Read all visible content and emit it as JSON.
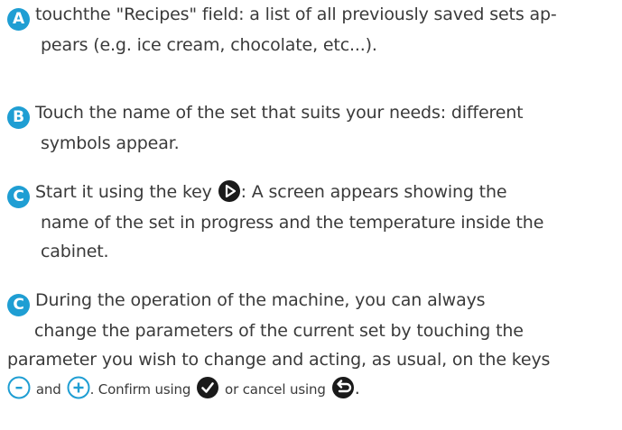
{
  "steps": [
    {
      "letter": "A",
      "line1": "touchthe \"Recipes\" field: a list of all previously saved sets ap-",
      "line2": "pears (e.g. ice cream, chocolate, etc...)."
    },
    {
      "letter": "B",
      "line1": "Touch the name of the set that suits your needs: different",
      "line2": "symbols appear."
    },
    {
      "letter": "C",
      "line1_before": "Start it using the key",
      "line1_after": ": A screen appears showing the",
      "line2": "name of the set in progress and the temperature inside the",
      "line3": "cabinet."
    },
    {
      "letter": "C",
      "line1": "During the operation of the machine, you can always",
      "line2": "change the parameters of the current set by touching the",
      "line3": "parameter you wish to change and acting, as usual, on the keys",
      "and_word": "and",
      "confirm_text": ". Confirm using",
      "cancel_text": "or cancel using",
      "end": "."
    }
  ],
  "colors": {
    "accent": "#1f9ed3",
    "text": "#3a3a3a",
    "icon_dark": "#1a1a1a"
  },
  "icons": [
    "play-icon",
    "minus-icon",
    "plus-icon",
    "check-icon",
    "undo-icon"
  ]
}
